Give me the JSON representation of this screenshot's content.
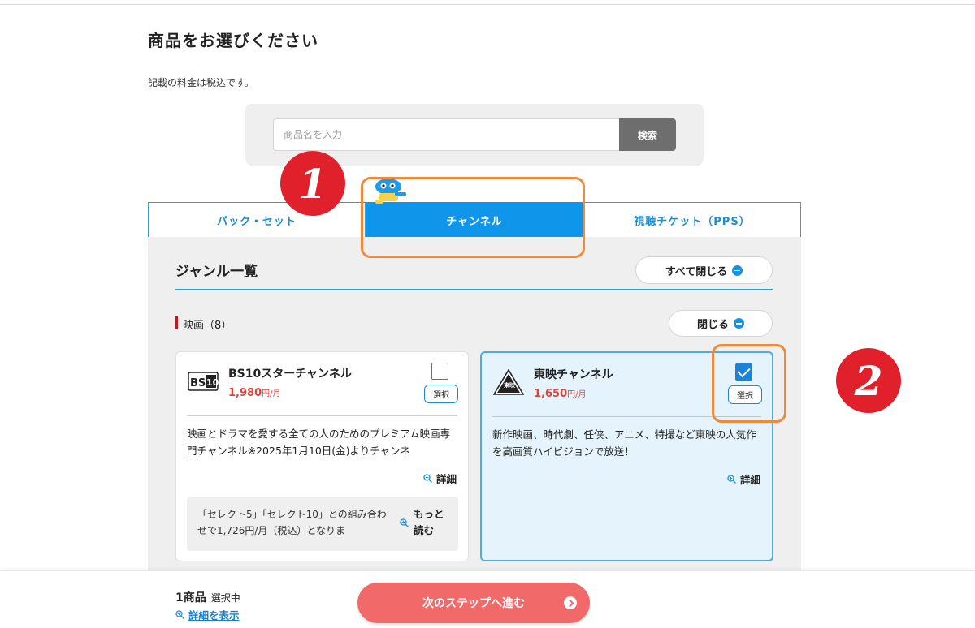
{
  "header": {
    "title": "商品をお選びください",
    "tax_note": "記載の料金は税込です。"
  },
  "search": {
    "placeholder": "商品名を入力",
    "button_label": "検索"
  },
  "annotations": {
    "badge_1": "1",
    "badge_2": "2",
    "highlight_color": "#f08a3a",
    "badge_color": "#e0202a"
  },
  "tabs": [
    {
      "label": "パック・セット",
      "active": false
    },
    {
      "label": "チャンネル",
      "active": true
    },
    {
      "label": "視聴チケット（PPS）",
      "active": false
    }
  ],
  "genre": {
    "heading": "ジャンル一覧",
    "close_all_label": "すべて閉じる"
  },
  "category": {
    "label": "映画（8）",
    "close_label": "閉じる"
  },
  "cards": [
    {
      "logo_icon": "bs10-logo-icon",
      "name": "BS10スターチャンネル",
      "price": "1,980",
      "unit": "円/月",
      "selected": false,
      "select_label": "選択",
      "description": "映画とドラマを愛する全ての人のためのプレミアム映画専門チャンネル※2025年1月10日(金)よりチャンネ",
      "detail_label": "詳細",
      "note": "「セレクト5」「セレクト10」との組み合わせで1,726円/月（税込）となりま",
      "more_label": "もっと読む"
    },
    {
      "logo_icon": "toei-logo-icon",
      "name": "東映チャンネル",
      "price": "1,650",
      "unit": "円/月",
      "selected": true,
      "select_label": "選択",
      "description": "新作映画、時代劇、任侠、アニメ、特撮など東映の人気作を高画質ハイビジョンで放送！",
      "detail_label": "詳細"
    }
  ],
  "footer": {
    "count": "1商品",
    "count_suffix": "選択中",
    "detail_link": "詳細を表示",
    "next_label": "次のステップへ進む"
  },
  "colors": {
    "accent_blue": "#0f96ea",
    "price_red": "#e1423b",
    "next_button": "#f2696a"
  }
}
